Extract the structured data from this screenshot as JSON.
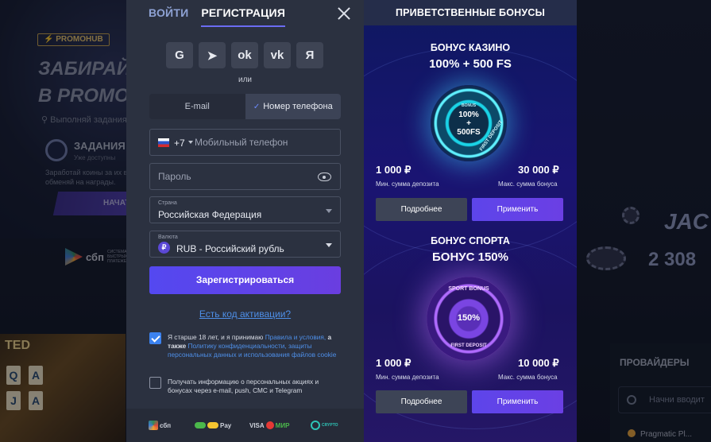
{
  "background": {
    "promo_badge": "⚡ PROMOHUB",
    "promo_title": "ЗАБИРАЙ\nВ PROMO",
    "promo_sub": "⚲ Выполняй задания",
    "tasks_title": "ЗАДАНИЯ",
    "tasks_sub": "Уже доступны",
    "tasks_desc": "Заработай коины за их в\nобменяй на награды.",
    "start_label": "НАЧАТ",
    "sbp_label": "сбп",
    "sbp_small": "СИСТЕМА БЫСТРЫХ ПЛАТЕЖЕЙ",
    "slots_text": "TED",
    "jackpot_title": "JAC",
    "jackpot_value": "2 308",
    "providers_title": "ПРОВАЙДЕРЫ",
    "providers_search_placeholder": "Начни вводит",
    "provider_item": "Pragmatic Pl..."
  },
  "modal": {
    "tabs": [
      {
        "label": "ВОЙТИ",
        "active": false
      },
      {
        "label": "РЕГИСТРАЦИЯ",
        "active": true
      }
    ],
    "socials": [
      {
        "icon": "google-icon",
        "glyph": "G"
      },
      {
        "icon": "telegram-icon",
        "glyph": "➤"
      },
      {
        "icon": "odnoklassniki-icon",
        "glyph": "ok"
      },
      {
        "icon": "vk-icon",
        "glyph": "vk"
      },
      {
        "icon": "yandex-icon",
        "glyph": "Я"
      }
    ],
    "or_text": "или",
    "method": {
      "email": "E-mail",
      "phone": "Номер телефона",
      "selected": "phone"
    },
    "phone": {
      "code": "+7",
      "placeholder": "Мобильный телефон"
    },
    "password": {
      "placeholder": "Пароль"
    },
    "country": {
      "label": "Страна",
      "value": "Российская Федерация"
    },
    "currency": {
      "label": "Валюта",
      "symbol": "₽",
      "value": "RUB - Российский рубль"
    },
    "submit_label": "Зарегистрироваться",
    "promo_link": "Есть код активации?",
    "consent1": {
      "checked": true,
      "text_a": "Я старше 18 лет, и я принимаю ",
      "link_a": "Правила и условия,",
      "text_b": " а также ",
      "link_b": "Политику конфиденциальности, защиты персональных данных и использования файлов cookie"
    },
    "consent2": {
      "checked": false,
      "text": "Получать информацию о персональных акциях и бонусах через e-mail, push, СМС и Telegram"
    },
    "payments": {
      "sbp": "сбп",
      "pays": "Pay",
      "visa": "VISA",
      "mir": "МИР",
      "crypto": "CRYPTO"
    }
  },
  "bonuses": {
    "header": "ПРИВЕТСТВЕННЫЕ БОНУСЫ",
    "casino": {
      "title": "БОНУС КАЗИНО",
      "subtitle": "100% + 500 FS",
      "wheel_small": "BONUS",
      "wheel_main": "100%\n+\n500FS",
      "wheel_ring": "FIRST DEPOSIT",
      "min_value": "1 000 ₽",
      "min_label": "Мин. сумма депозита",
      "max_value": "30 000 ₽",
      "max_label": "Макс. сумма бонуса",
      "more_label": "Подробнее",
      "apply_label": "Применить"
    },
    "sport": {
      "title": "БОНУС СПОРТА",
      "subtitle": "БОНУС 150%",
      "wheel_ring": "SPORT BONUS",
      "wheel_main": "150%",
      "wheel_bottom": "FIRST DEPOSIT",
      "min_value": "1 000 ₽",
      "min_label": "Мин. сумма депозита",
      "max_value": "10 000 ₽",
      "max_label": "Макс. сумма бонуса",
      "more_label": "Подробнее",
      "apply_label": "Применить"
    }
  }
}
